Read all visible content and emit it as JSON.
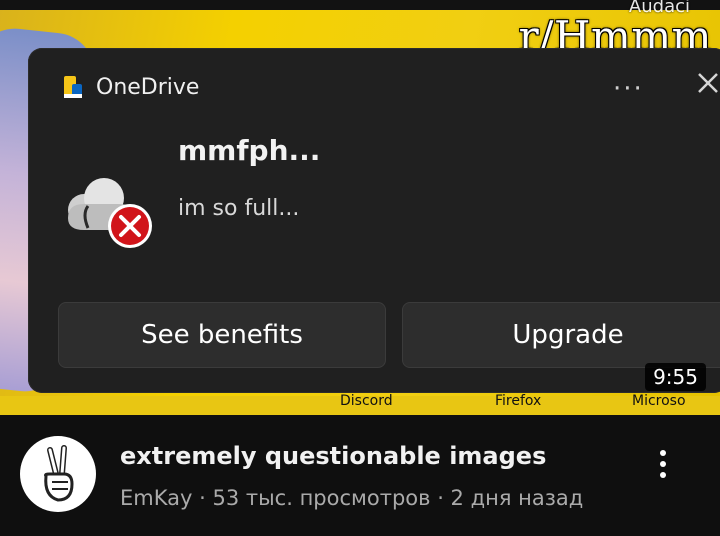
{
  "thumbnail": {
    "subreddit": "r/Hmmm",
    "subreddit_fragment": "Audaci",
    "duration": "9:55",
    "strip_labels": [
      "Discord",
      "Firefox",
      "Microso"
    ]
  },
  "notification": {
    "app_name": "OneDrive",
    "more_label": "···",
    "title": "mmfph...",
    "message": "im so full...",
    "buttons": {
      "benefits": "See benefits",
      "upgrade": "Upgrade"
    }
  },
  "video": {
    "title": "extremely questionable images",
    "channel": "EmKay",
    "separator": " · ",
    "views": "53 тыс. просмотров",
    "age": "2 дня назад"
  },
  "colors": {
    "thumbnail_yellow": "#f4d000",
    "card_bg": "#202020",
    "error_red": "#d1141a",
    "page_bg": "#0f0f0f"
  }
}
